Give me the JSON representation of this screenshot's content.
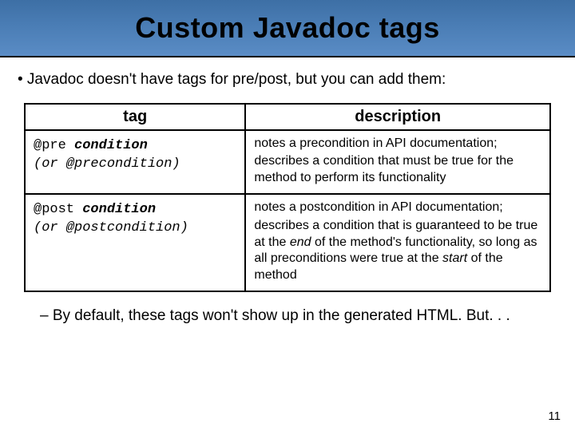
{
  "title": "Custom Javadoc tags",
  "bullet": "• Javadoc doesn't have tags for pre/post, but you can add them:",
  "table": {
    "headers": {
      "tag": "tag",
      "desc": "description"
    },
    "rows": [
      {
        "tag_prefix": "@pre ",
        "tag_arg": "condition",
        "tag_alt": "(or @precondition)",
        "desc_line1": "notes a precondition in API documentation;",
        "desc_line2_a": "describes a condition that must be true for the method to perform its functionality",
        "desc_line2_b": ""
      },
      {
        "tag_prefix": "@post ",
        "tag_arg": "condition",
        "tag_alt": "(or @postcondition)",
        "desc_line1": "notes a postcondition in API documentation;",
        "desc_line2_a": "describes a condition that is guaranteed to be true at the ",
        "desc_end_word": "end",
        "desc_line2_b": " of the method's functionality, so long as all preconditions were true at the ",
        "desc_start_word": "start",
        "desc_line2_c": " of the method"
      }
    ]
  },
  "sub_bullet": "– By default, these tags won't show up in the generated HTML. But. . .",
  "page_number": "11"
}
